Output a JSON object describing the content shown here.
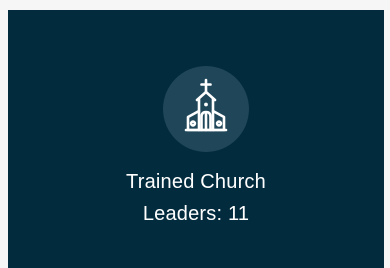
{
  "card": {
    "background_color": "#022b3d",
    "icon": "church-icon",
    "icon_circle_color": "#1f4659",
    "title_line1": "Trained Church",
    "title_line2": "Leaders: 11"
  }
}
